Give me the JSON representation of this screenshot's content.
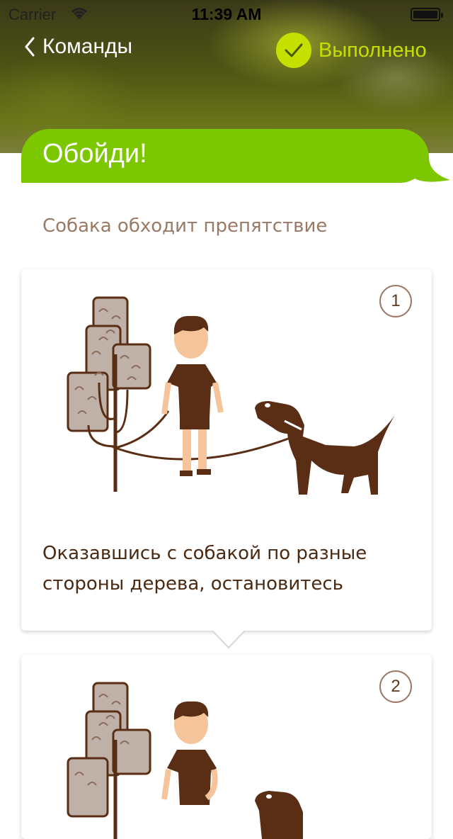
{
  "status_bar": {
    "carrier": "Carrier",
    "time": "11:39 AM"
  },
  "nav": {
    "back_label": "Команды",
    "done_label": "Выполнено"
  },
  "command": {
    "title": "Обойди!",
    "subtitle": "Собака обходит препятствие"
  },
  "steps": [
    {
      "number": "1",
      "caption": "Оказавшись с собакой по разные стороны дерева, остановитесь"
    },
    {
      "number": "2",
      "caption": ""
    }
  ],
  "icons": {
    "back": "chevron-left-icon",
    "done": "checkmark-icon",
    "wifi": "wifi-icon",
    "battery": "battery-icon"
  },
  "colors": {
    "accent_green": "#7dc700",
    "done_lime": "#c5e000",
    "text_brown": "#4b2a12",
    "subtitle_brown": "#9b7a65",
    "illustration_brown": "#5a2e14",
    "illustration_skin": "#f5c49a"
  }
}
